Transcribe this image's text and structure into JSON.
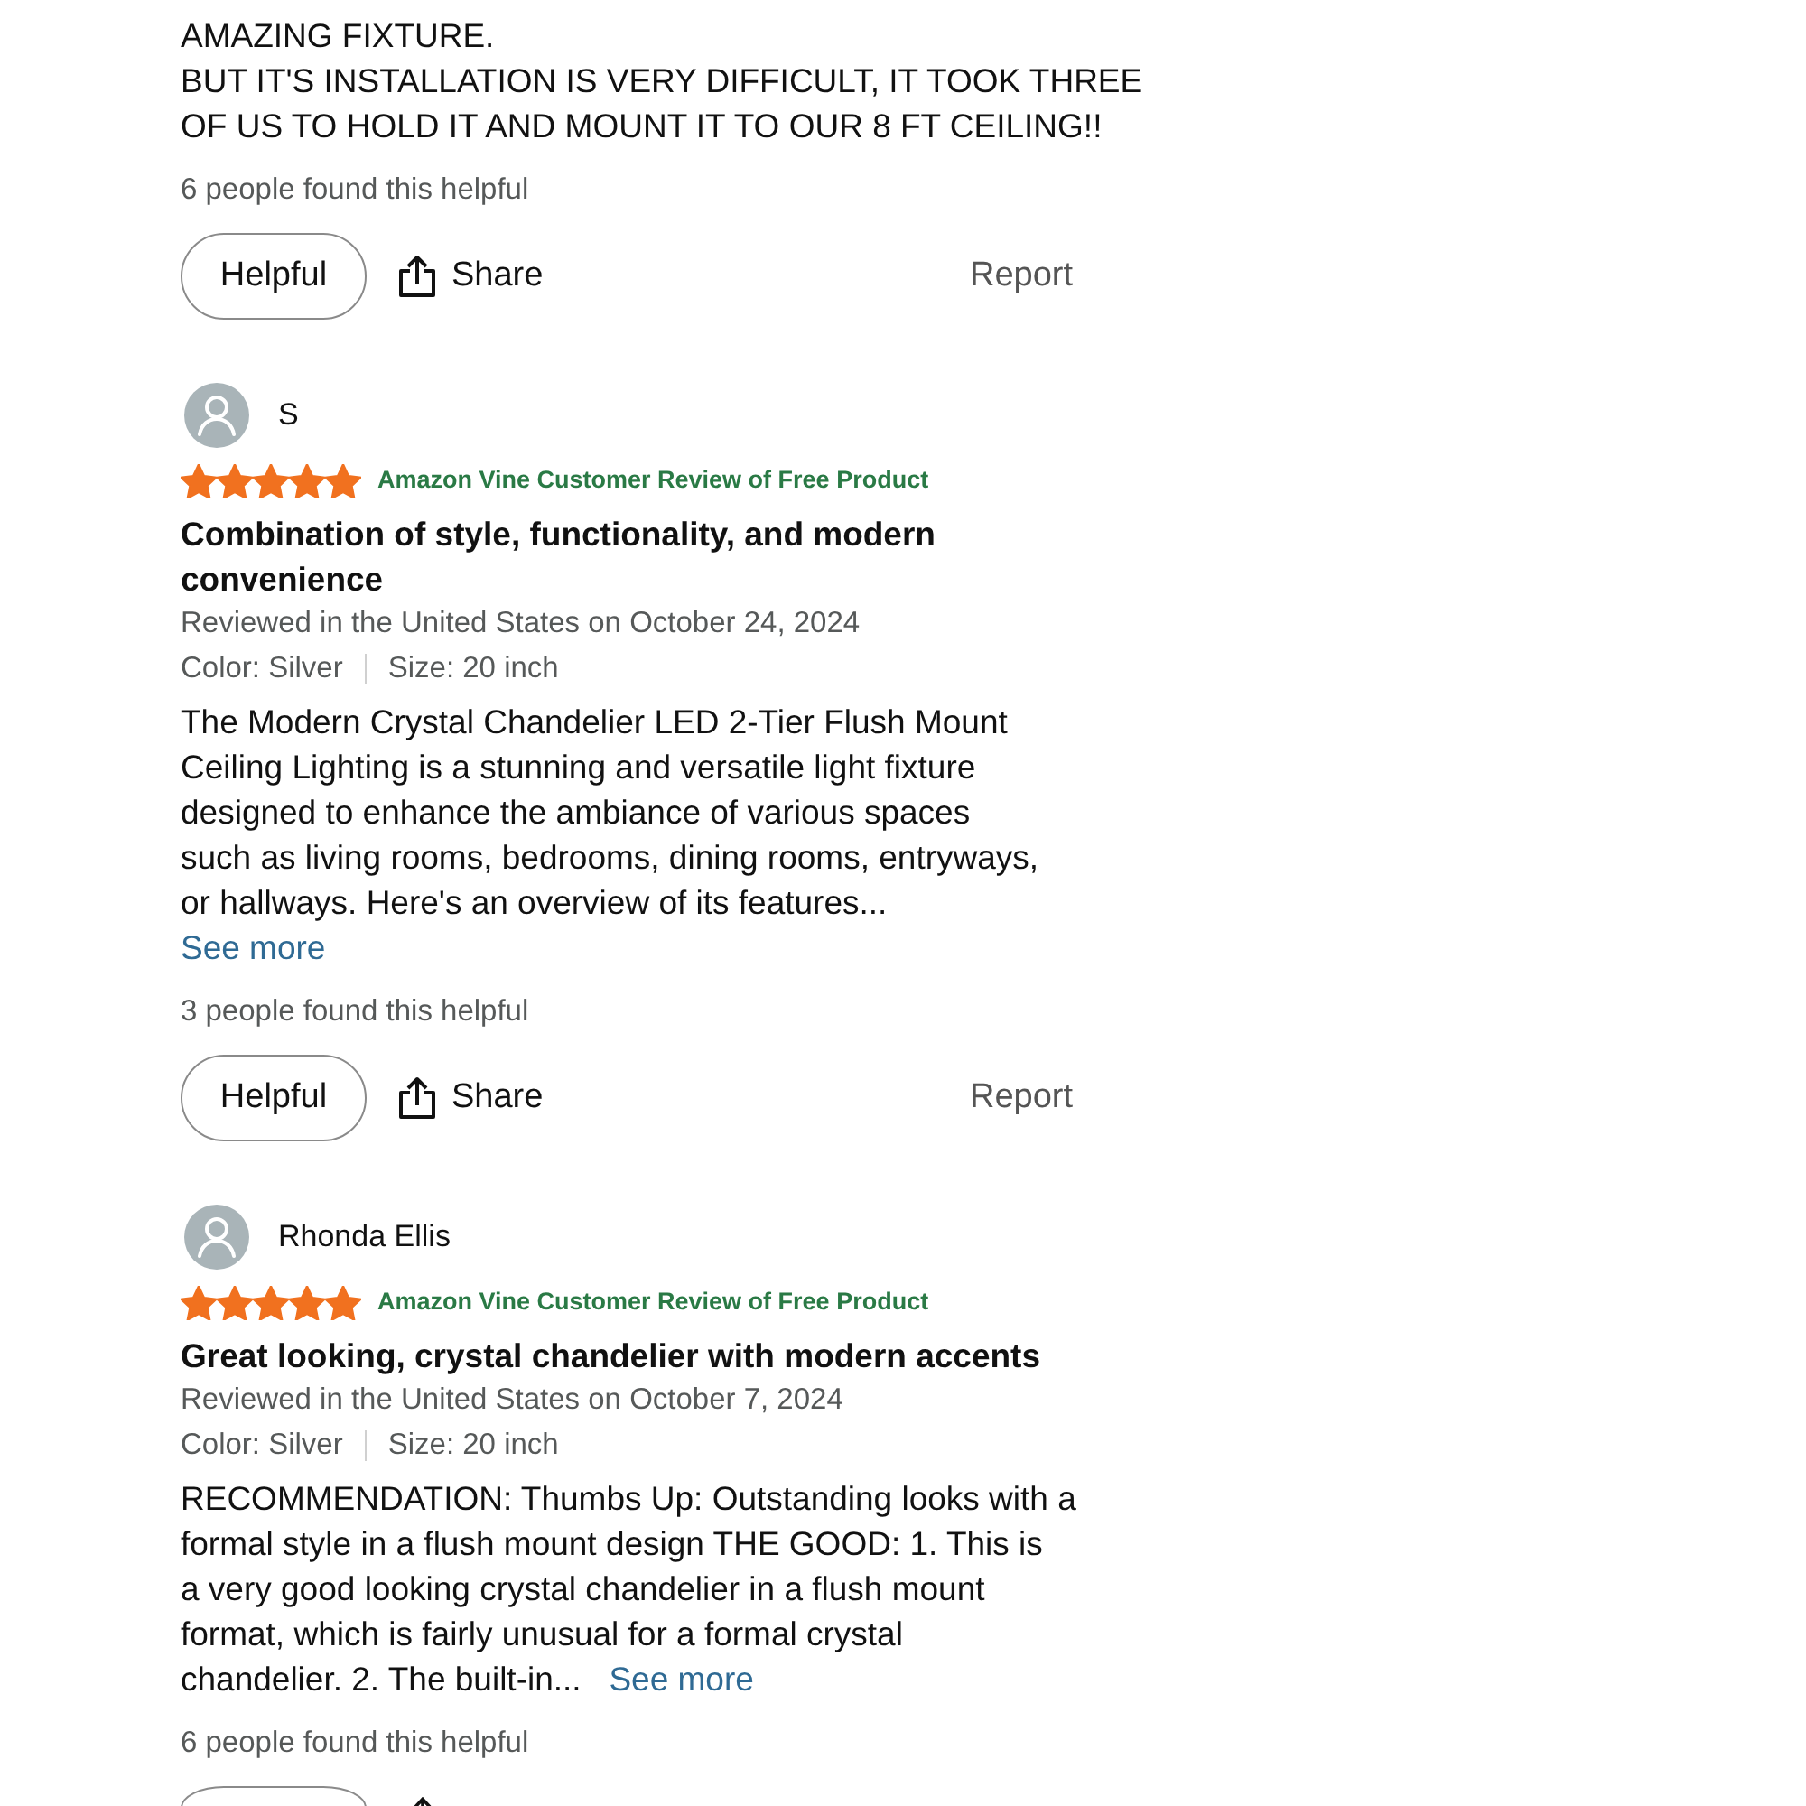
{
  "reviews": [
    {
      "body": "AMAZING FIXTURE.\nBUT IT'S INSTALLATION IS VERY DIFFICULT, IT TOOK THREE\nOF US TO HOLD IT AND MOUNT IT TO OUR 8 FT CEILING!!",
      "helpful_count": "6 people found this helpful",
      "actions": {
        "helpful": "Helpful",
        "share": "Share",
        "report": "Report"
      }
    },
    {
      "reviewer": "S",
      "stars": 5,
      "badge": "Amazon Vine Customer Review of Free Product",
      "title": "Combination of style, functionality, and modern convenience",
      "date": "Reviewed in the United States on October 24, 2024",
      "attributes": [
        "Color: Silver",
        "Size: 20 inch"
      ],
      "body": "The Modern Crystal Chandelier LED 2-Tier Flush Mount\nCeiling Lighting is a stunning and versatile light fixture\ndesigned to enhance the ambiance of various spaces\nsuch as living rooms, bedrooms, dining rooms, entryways,\nor hallways. Here's an overview of its features...\n",
      "see_more": "See more",
      "helpful_count": "3 people found this helpful",
      "actions": {
        "helpful": "Helpful",
        "share": "Share",
        "report": "Report"
      }
    },
    {
      "reviewer": "Rhonda Ellis",
      "stars": 5,
      "badge": "Amazon Vine Customer Review of Free Product",
      "title": "Great looking, crystal chandelier with modern accents",
      "date": "Reviewed in the United States on October 7, 2024",
      "attributes": [
        "Color: Silver",
        "Size: 20 inch"
      ],
      "body": "RECOMMENDATION: Thumbs Up: Outstanding looks with a\nformal style in a flush mount design THE GOOD: 1. This is\na very good looking crystal chandelier in a flush mount\nformat, which is fairly unusual for a formal crystal\nchandelier. 2. The built-in...   ",
      "see_more": "See more",
      "helpful_count": "6 people found this helpful",
      "actions": {
        "cut_off": true
      }
    }
  ]
}
